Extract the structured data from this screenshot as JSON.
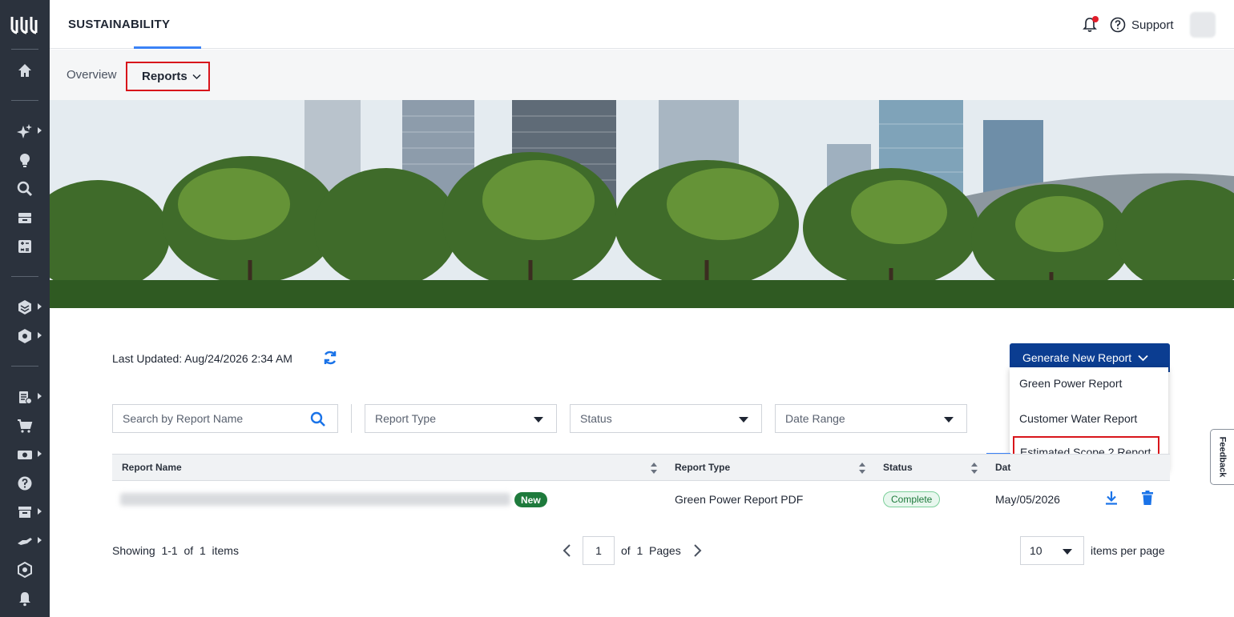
{
  "app": {
    "title": "SUSTAINABILITY",
    "support_label": "Support",
    "notification_icon": "bell-icon",
    "help_icon": "question-circle-icon"
  },
  "rail": {
    "icons": [
      "equinix-logo",
      "home-icon",
      "sparkle-icon",
      "lightbulb-icon",
      "search-icon",
      "inventory-icon",
      "calculator-icon",
      "layers-icon",
      "hexagon-settings-icon",
      "orders-icon",
      "cart-icon",
      "billing-icon",
      "help-icon",
      "archive-icon",
      "handshake-icon",
      "network-icon",
      "bell-icon"
    ]
  },
  "subnav": {
    "overview": "Overview",
    "reports": "Reports"
  },
  "content": {
    "last_updated": "Last Updated: Aug/24/2026 2:34 AM",
    "generate_button": "Generate New Report",
    "menu_items": [
      "Green Power Report",
      "Customer Water Report",
      "Estimated Scope 2 Report"
    ],
    "search_placeholder": "Search by Report Name",
    "filters": {
      "report_type": "Report Type",
      "status": "Status",
      "date_range": "Date Range"
    }
  },
  "table": {
    "headers": [
      "Report Name",
      "Report Type",
      "Status",
      "Dat"
    ],
    "rows": [
      {
        "badge": "New",
        "report_type": "Green Power Report PDF",
        "status": "Complete",
        "date": "May/05/2026"
      }
    ]
  },
  "pagination": {
    "showing": "Showing  1-1  of  1  items",
    "page": "1",
    "of_pages": "of  1  Pages",
    "per_page": "10",
    "per_page_label": "items per page"
  },
  "feedback": "Feedback",
  "colors": {
    "rail": "#2b323d",
    "primary_button": "#0b3d91",
    "highlight": "#d8151b",
    "accent": "#3b82f6",
    "success": "#1e7a3c"
  }
}
